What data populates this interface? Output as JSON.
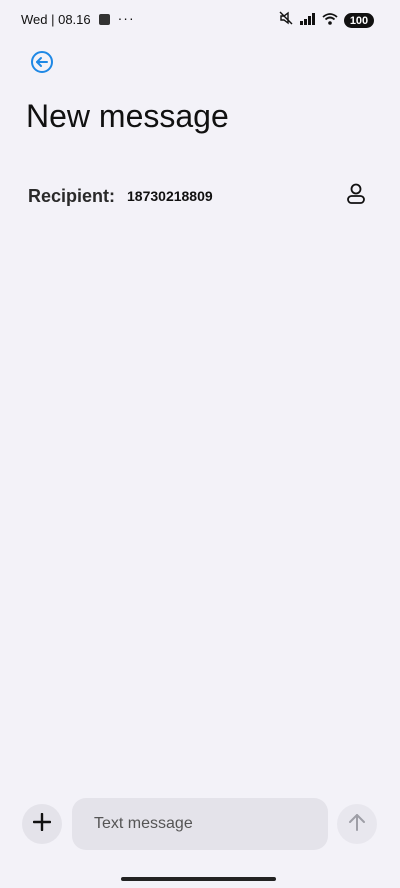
{
  "status_bar": {
    "time_text": "Wed | 08.16",
    "overflow_dots": "···",
    "battery": "100",
    "icons": [
      "notification-square-icon",
      "mute-icon",
      "signal-icon",
      "wifi-icon",
      "battery-icon"
    ]
  },
  "header": {
    "back_icon": "back-arrow-icon",
    "title": "New message"
  },
  "recipient": {
    "label": "Recipient:",
    "value": "18730218809",
    "contact_icon": "person-icon"
  },
  "composer": {
    "attach_icon": "plus-icon",
    "placeholder": "Text message",
    "value": "",
    "send_icon": "send-arrow-up-icon"
  },
  "colors": {
    "background": "#f3f2f8",
    "accent": "#1e88e5",
    "input_background": "#e4e3ea"
  }
}
